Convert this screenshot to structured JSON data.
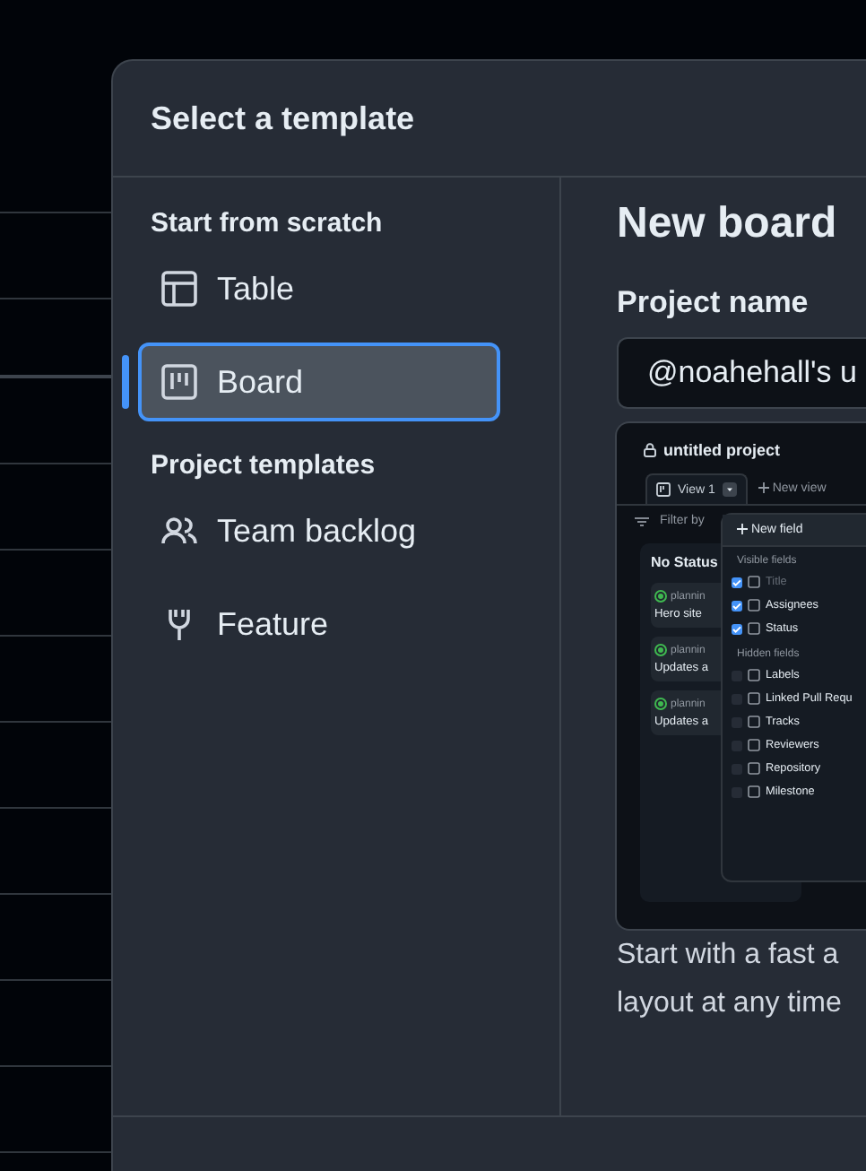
{
  "dialog": {
    "title": "Select a template"
  },
  "sidebar": {
    "sections": [
      {
        "heading": "Start from scratch",
        "items": [
          {
            "label": "Table",
            "selected": false
          },
          {
            "label": "Board",
            "selected": true
          }
        ]
      },
      {
        "heading": "Project templates",
        "items": [
          {
            "label": "Team backlog",
            "selected": false
          },
          {
            "label": "Feature",
            "selected": false
          }
        ]
      }
    ]
  },
  "main": {
    "title": "New board",
    "field_label": "Project name",
    "field_value": "@noahehall's u",
    "preview": {
      "project": "untitled project",
      "tabs": [
        {
          "label": "View 1",
          "selected": true
        }
      ],
      "new_view": "New view",
      "filter": "Filter by",
      "column": "No Status",
      "cards": [
        {
          "tag": "plannin",
          "title": "Hero site"
        },
        {
          "tag": "plannin",
          "title": "Updates a"
        },
        {
          "tag": "plannin",
          "title": "Updates a"
        }
      ],
      "menu": {
        "new_field": "New field",
        "sections": [
          {
            "heading": "Visible fields",
            "fields": [
              {
                "label": "Title",
                "checked": true,
                "disabled": true
              },
              {
                "label": "Assignees",
                "checked": true,
                "disabled": false
              },
              {
                "label": "Status",
                "checked": true,
                "disabled": false
              }
            ]
          },
          {
            "heading": "Hidden fields",
            "fields": [
              {
                "label": "Labels",
                "checked": false,
                "disabled": false
              },
              {
                "label": "Linked Pull Requ",
                "checked": false,
                "disabled": false
              },
              {
                "label": "Tracks",
                "checked": false,
                "disabled": false
              },
              {
                "label": "Reviewers",
                "checked": false,
                "disabled": false
              },
              {
                "label": "Repository",
                "checked": false,
                "disabled": false
              },
              {
                "label": "Milestone",
                "checked": false,
                "disabled": false
              }
            ]
          }
        ]
      }
    },
    "description": [
      "Start with a fast a",
      "layout at any time"
    ]
  }
}
